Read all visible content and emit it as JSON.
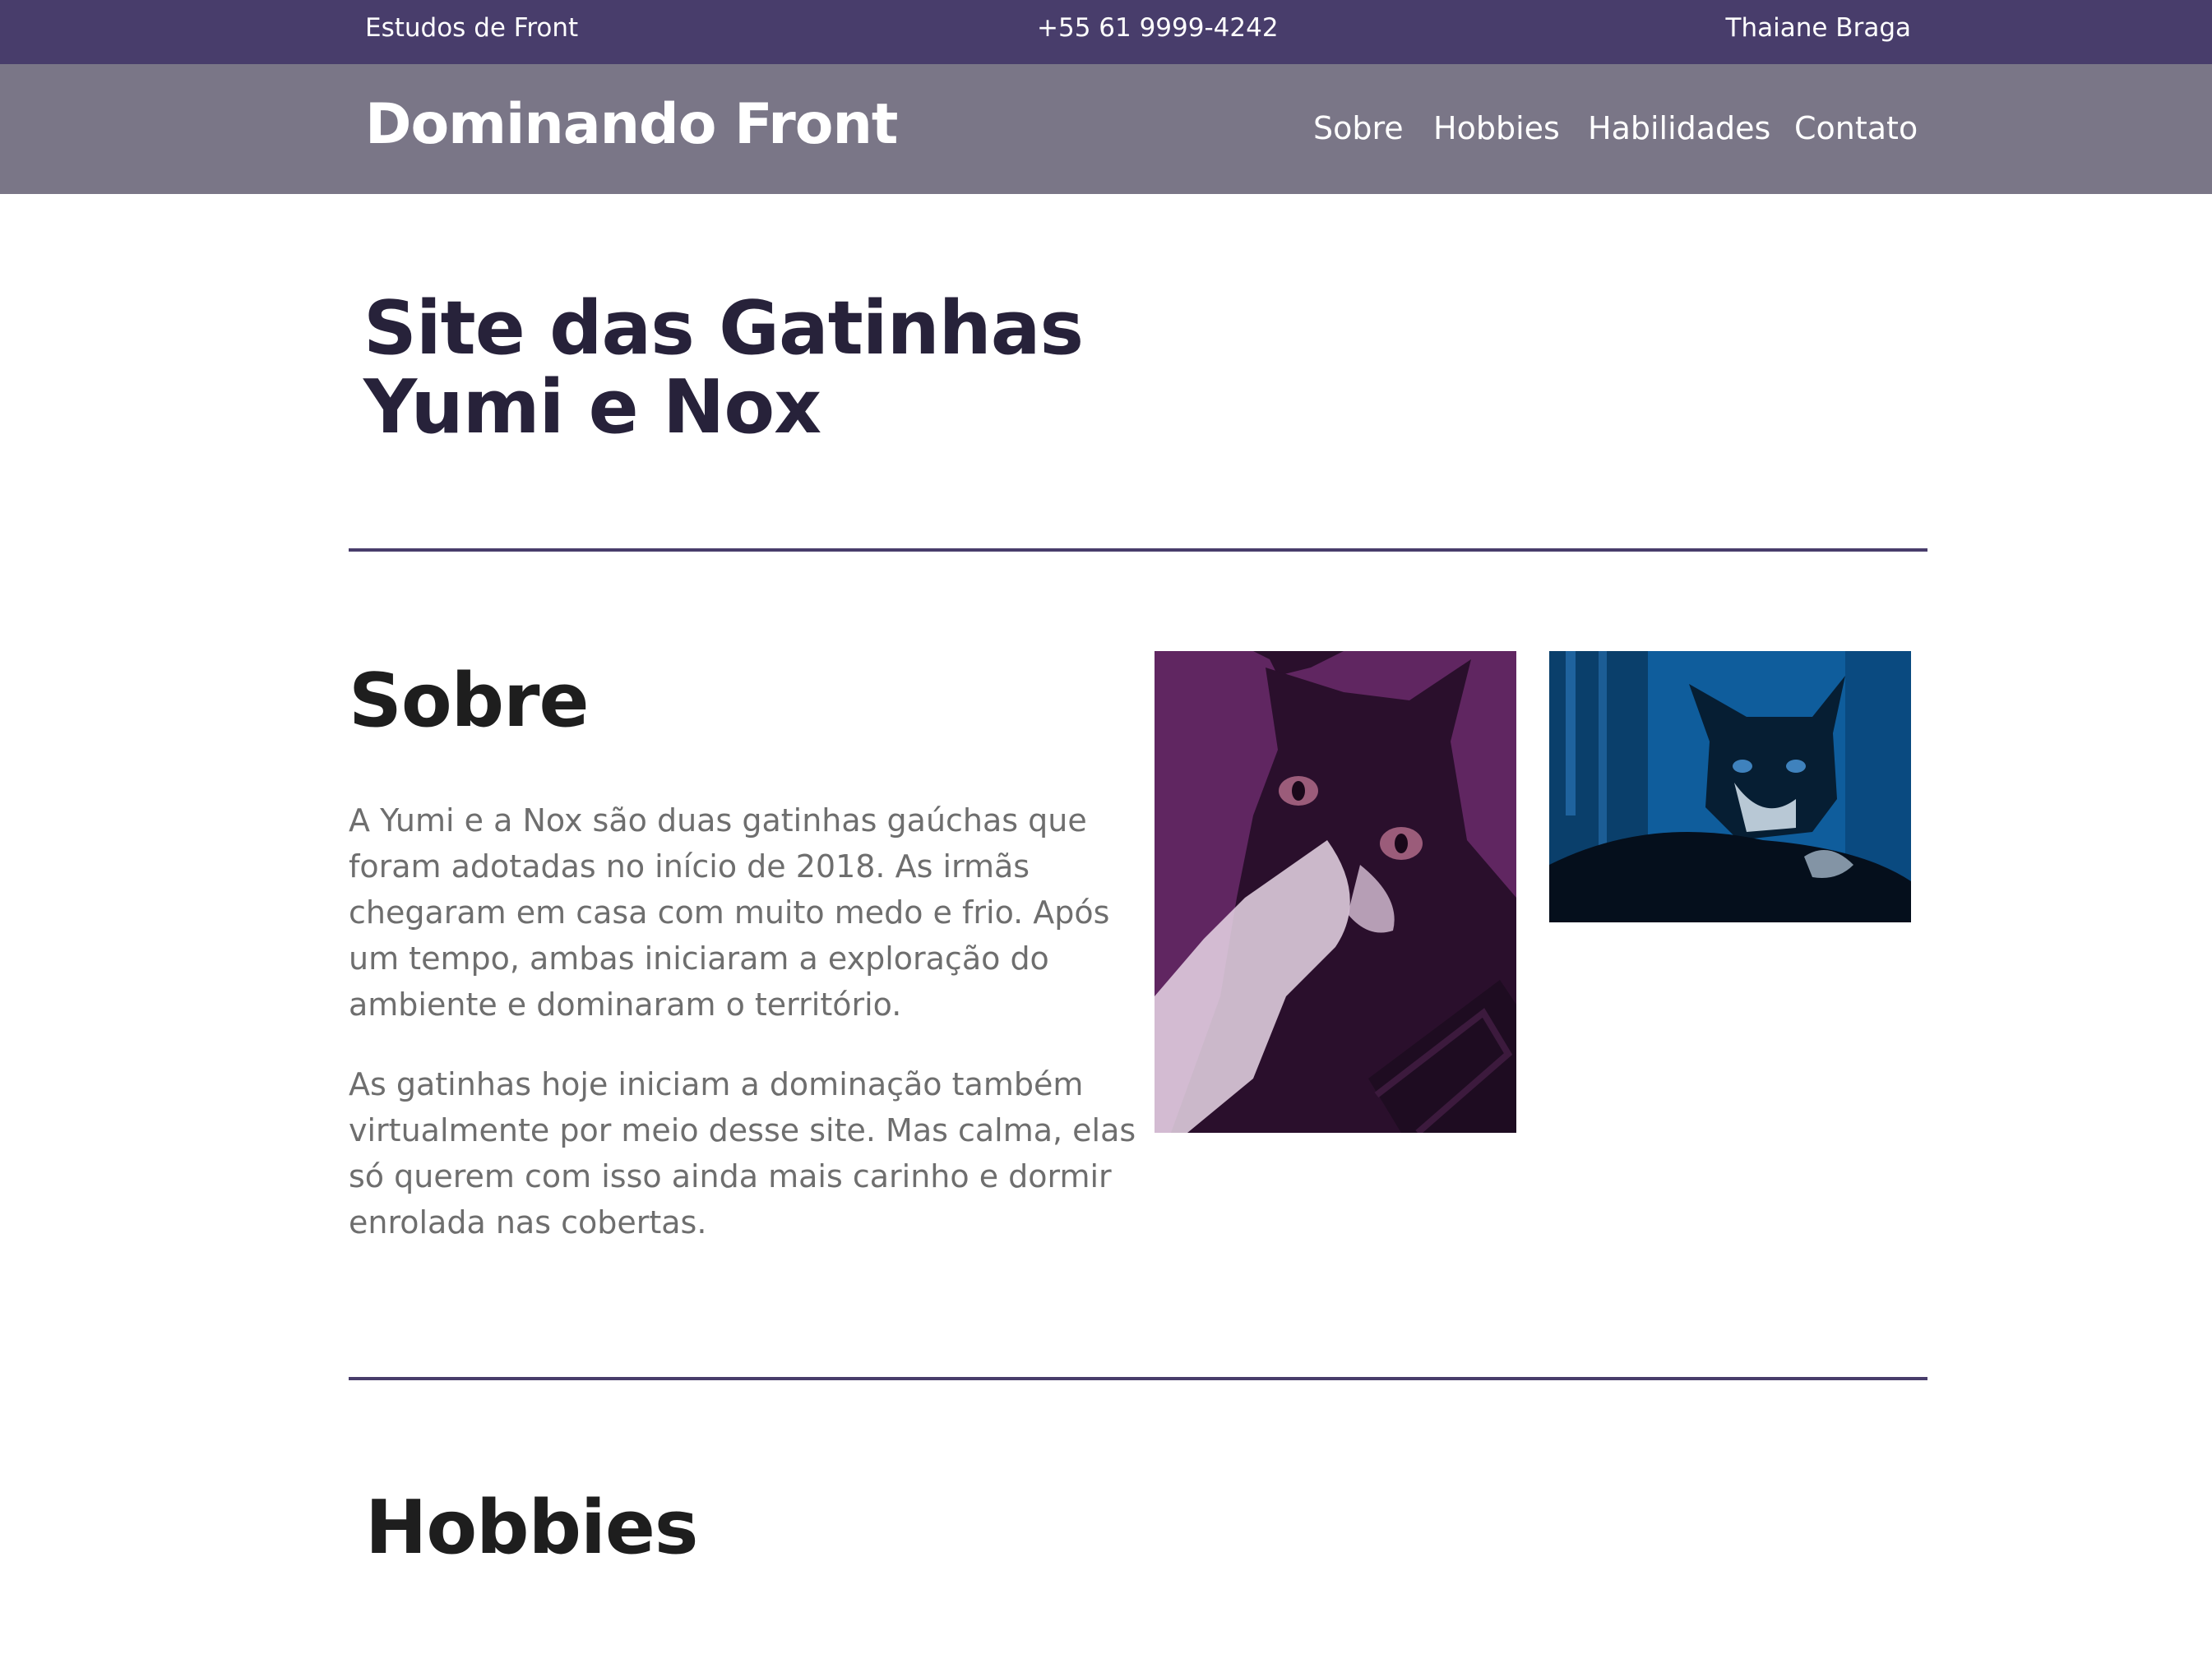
{
  "topbar": {
    "left": "Estudos de Front",
    "phone": "+55 61 9999-4242",
    "author": "Thaiane Braga"
  },
  "nav": {
    "brand": "Dominando Front",
    "links": [
      "Sobre",
      "Hobbies",
      "Habilidades",
      "Contato"
    ]
  },
  "hero": {
    "line1": "Site das Gatinhas",
    "line2": "Yumi e Nox"
  },
  "sobre": {
    "title": "Sobre",
    "p1": "A Yumi e a Nox são duas gatinhas gaúchas que foram adotadas no início de 2018. As irmãs chegaram em casa com muito medo e frio. Após um tempo, ambas iniciaram a exploração do ambiente e dominaram o território.",
    "p2": "As gatinhas hoje iniciam a dominação também virtualmente por meio desse site. Mas calma, elas só querem com isso ainda mais carinho e dormir enrolada nas cobertas."
  },
  "hobbies": {
    "title": "Hobbies"
  },
  "colors": {
    "topbar": "#483d6b",
    "nav": "#7a7687",
    "divider": "#483d6b",
    "photo1_tint": "#6b2a6a",
    "photo2_tint": "#0f5d9c"
  }
}
